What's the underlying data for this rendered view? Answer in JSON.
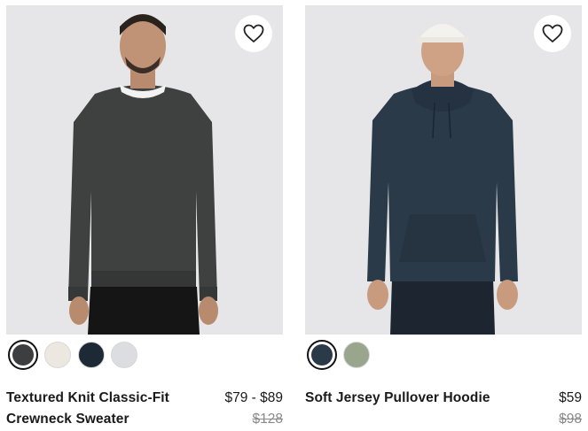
{
  "products": [
    {
      "name": "Textured Knit Classic-Fit Crewneck Sweater",
      "price": "$79 - $89",
      "original_price": "$128",
      "swatches": [
        {
          "color": "#3d3e3f",
          "selected": true
        },
        {
          "color": "#ece8e1",
          "selected": false
        },
        {
          "color": "#1d2a36",
          "selected": false
        },
        {
          "color": "#dcdde0",
          "selected": false
        }
      ],
      "wishlist_icon": "heart-outline-icon"
    },
    {
      "name": "Soft Jersey Pullover Hoodie",
      "price": "$59",
      "original_price": "$98",
      "swatches": [
        {
          "color": "#2b3a49",
          "selected": true
        },
        {
          "color": "#9aa58d",
          "selected": false
        }
      ],
      "wishlist_icon": "heart-outline-icon"
    }
  ],
  "colors": {
    "image_background": "#e6e6e8",
    "strikethrough_price": "#8a8a8a"
  }
}
